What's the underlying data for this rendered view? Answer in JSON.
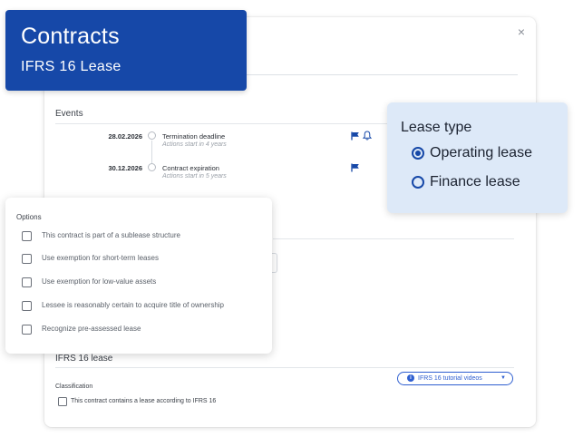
{
  "header": {
    "title": "Contracts",
    "subtitle": "IFRS 16 Lease"
  },
  "modal": {
    "close_icon": "×",
    "events": {
      "title": "Events",
      "items": [
        {
          "date": "28.02.2026",
          "name": "Termination deadline",
          "sub": "Actions start in 4 years",
          "flag": true,
          "bell": true
        },
        {
          "date": "30.12.2026",
          "name": "Contract expiration",
          "sub": "Actions start in 5 years",
          "flag": true,
          "bell": false
        }
      ]
    },
    "ifrs": {
      "title": "IFRS 16 lease",
      "tutorial_label": "IFRS 16 tutorial videos",
      "classification_label": "Classification",
      "lease_checkbox_label": "This contract contains a lease according to IFRS 16"
    }
  },
  "lease_type": {
    "title": "Lease type",
    "options": [
      {
        "label": "Operating lease",
        "selected": true
      },
      {
        "label": "Finance lease",
        "selected": false
      }
    ]
  },
  "options": {
    "title": "Options",
    "items": [
      {
        "label": "This contract is part of a sublease structure",
        "checked": false
      },
      {
        "label": "Use exemption for short-term leases",
        "checked": false
      },
      {
        "label": "Use exemption for low-value assets",
        "checked": false
      },
      {
        "label": "Lessee is reasonably certain to acquire title of ownership",
        "checked": false
      },
      {
        "label": "Recognize pre-assessed lease",
        "checked": false
      }
    ]
  },
  "colors": {
    "brand": "#1648a8",
    "accent_link": "#2f5fd0",
    "lease_bg": "#dde9f8"
  }
}
